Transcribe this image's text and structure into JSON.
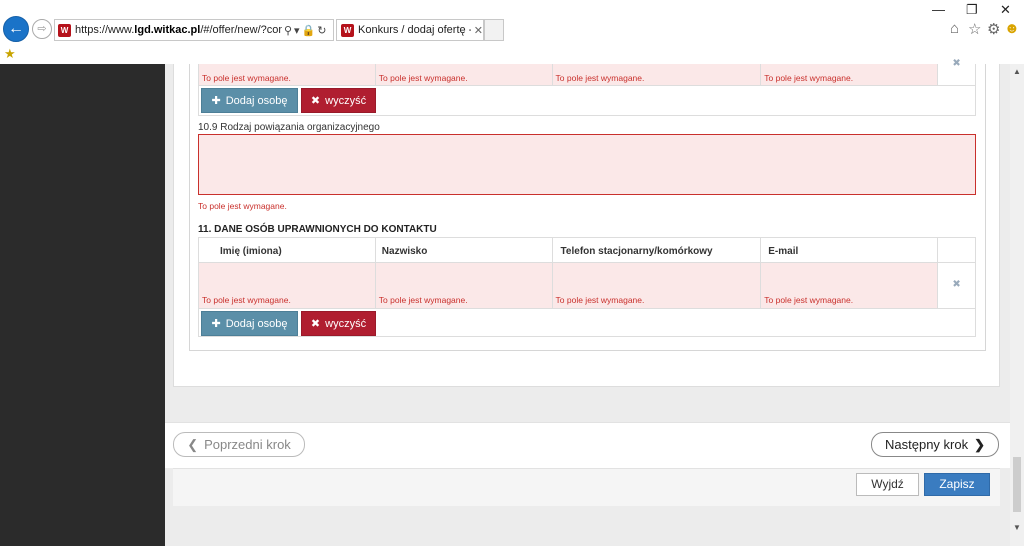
{
  "browser": {
    "url_prefix": "https://www.",
    "url_domain": "lgd.witkac.pl",
    "url_rest": "/#/offer/new/?contestid=",
    "tab_title": "Konkurs / dodaj ofertę - wit...",
    "favicon_text": "W"
  },
  "table1": {
    "errors": [
      "To pole jest wymagane.",
      "To pole jest wymagane.",
      "To pole jest wymagane.",
      "To pole jest wymagane."
    ],
    "add_label": "Dodaj osobę",
    "clear_label": "wyczyść"
  },
  "field_10_9": {
    "label": "10.9 Rodzaj powiązania organizacyjnego",
    "value": "",
    "error": "To pole jest wymagane."
  },
  "section_11": {
    "title": "11. DANE OSÓB UPRAWNIONYCH DO KONTAKTU",
    "columns": [
      "Imię (imiona)",
      "Nazwisko",
      "Telefon stacjonarny/komórkowy",
      "E-mail"
    ],
    "errors": [
      "To pole jest wymagane.",
      "To pole jest wymagane.",
      "To pole jest wymagane.",
      "To pole jest wymagane."
    ],
    "add_label": "Dodaj osobę",
    "clear_label": "wyczyść"
  },
  "nav": {
    "prev_label": "Poprzedni krok",
    "next_label": "Następny krok",
    "exit_label": "Wyjdź",
    "save_label": "Zapisz"
  },
  "colors": {
    "add_button": "#5b8fa8",
    "clear_button": "#b01e30",
    "save_button": "#3a7cc0",
    "error_text": "#c9302c",
    "error_bg": "#fbe8e8"
  }
}
